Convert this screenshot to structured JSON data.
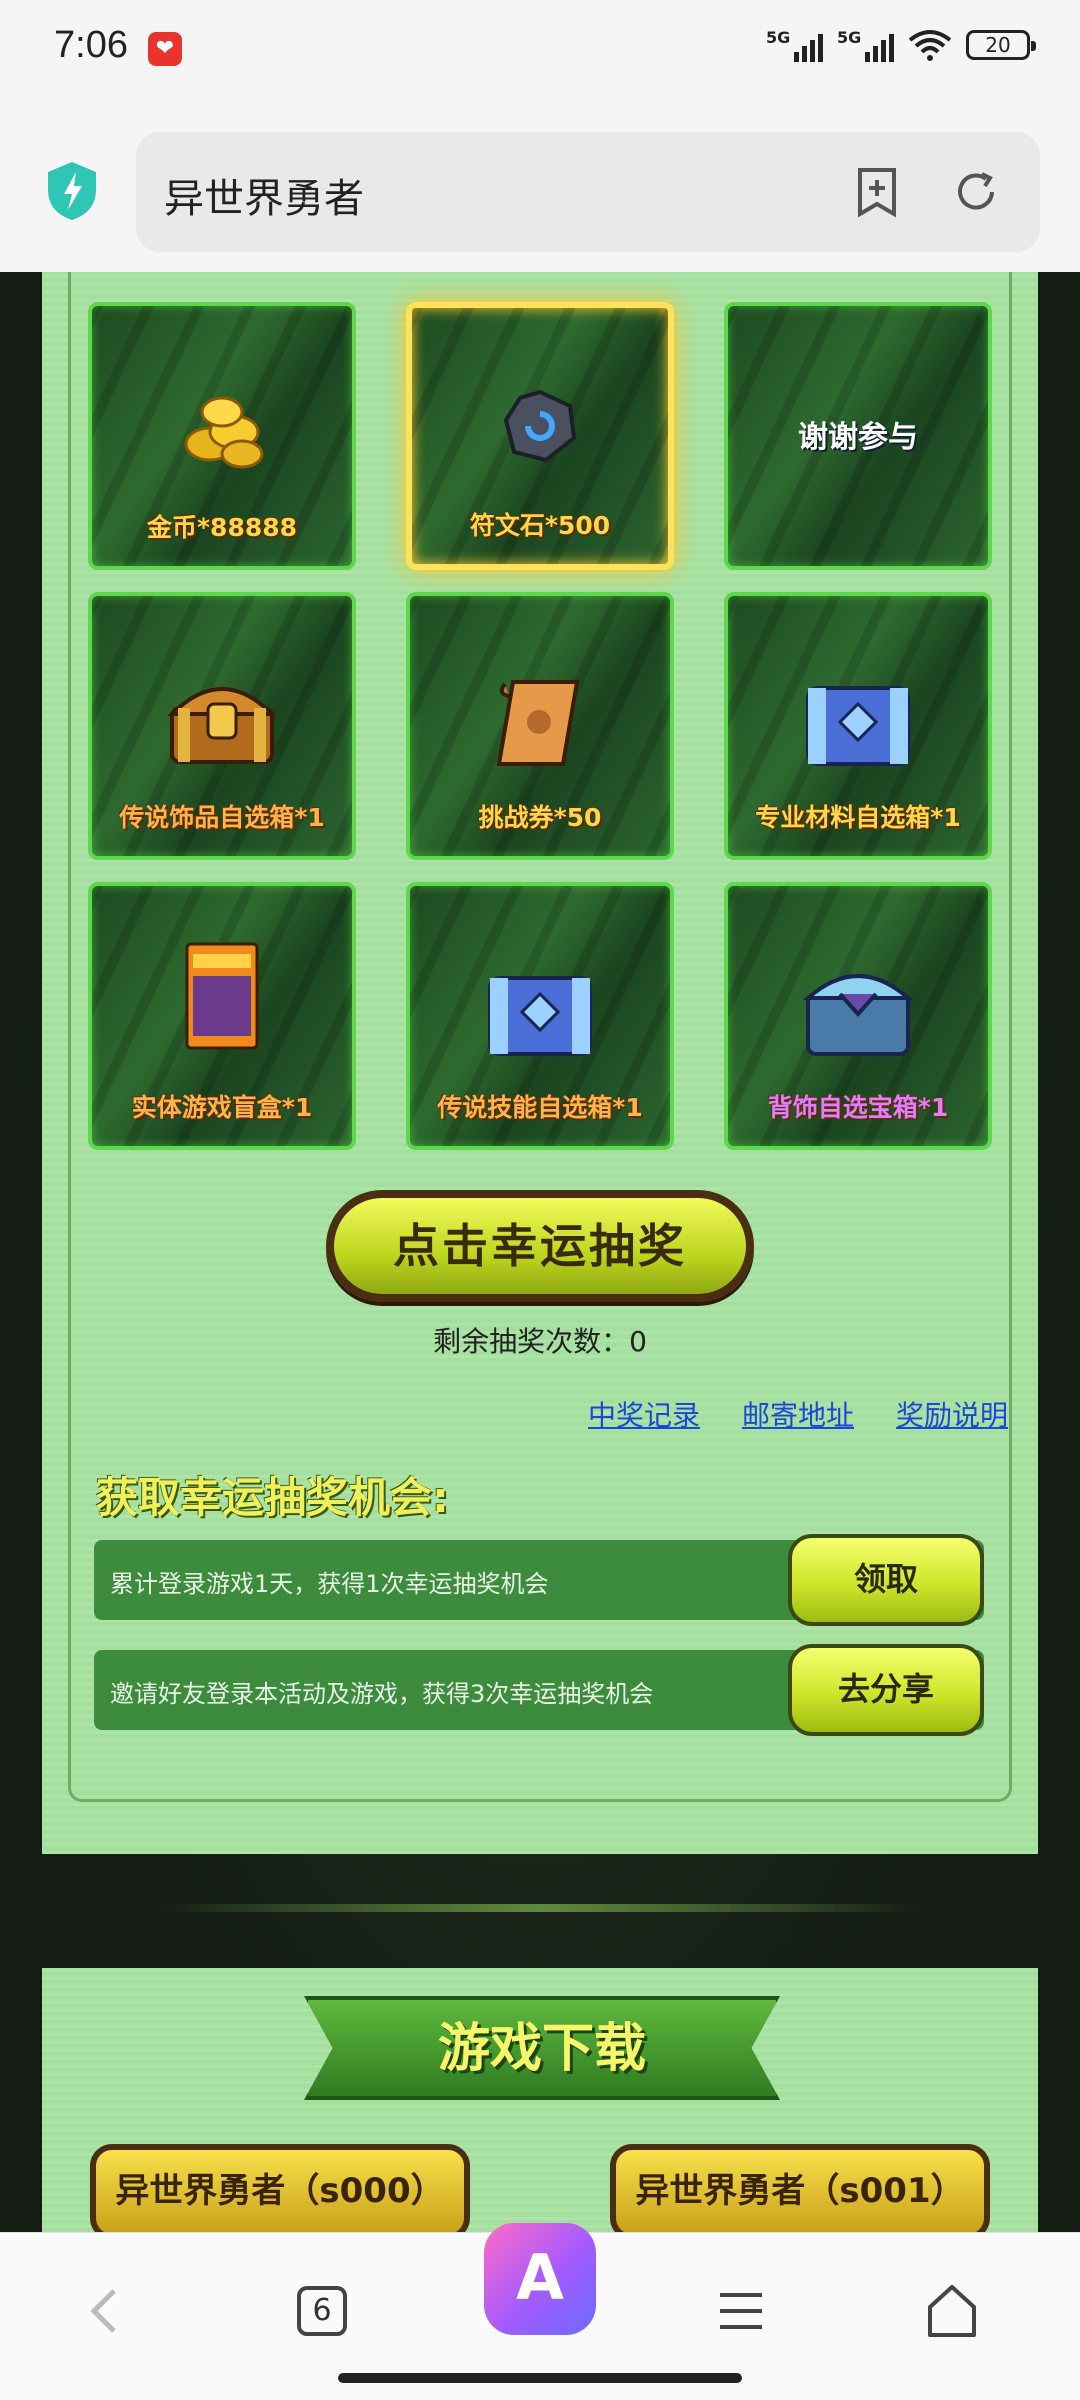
{
  "status_bar": {
    "time": "7:06",
    "app_badge_icon": "vivo-heart-icon",
    "network1": "5G",
    "network2": "5G",
    "battery": "20"
  },
  "address_bar": {
    "title": "异世界勇者",
    "icons": [
      "shield-bolt-icon",
      "bookmark-plus-icon",
      "reload-icon"
    ]
  },
  "prize_grid": [
    {
      "label": "金币*88888",
      "icon": "gold-coins-icon",
      "style": "gold"
    },
    {
      "label": "符文石*500",
      "icon": "rune-stone-icon",
      "style": "gold",
      "selected": true
    },
    {
      "label": "谢谢参与",
      "icon": "",
      "style": "white"
    },
    {
      "label": "传说饰品自选箱*1",
      "icon": "gold-chest-icon",
      "style": "orange"
    },
    {
      "label": "挑战券*50",
      "icon": "scroll-ticket-icon",
      "style": "gold"
    },
    {
      "label": "专业材料自选箱*1",
      "icon": "blue-chest-icon",
      "style": "gold"
    },
    {
      "label": "实体游戏盲盒*1",
      "icon": "blind-box-icon",
      "style": "orange"
    },
    {
      "label": "传说技能自选箱*1",
      "icon": "blue-chest-icon",
      "style": "orange"
    },
    {
      "label": "背饰自选宝箱*1",
      "icon": "purple-chest-icon",
      "style": "purple"
    }
  ],
  "draw": {
    "button_label": "点击幸运抽奖",
    "remaining_label": "剩余抽奖次数：",
    "remaining_count": "0"
  },
  "links": {
    "records": "中奖记录",
    "address": "邮寄地址",
    "rules": "奖励说明"
  },
  "get_chances": {
    "title": "获取幸运抽奖机会:",
    "tasks": [
      {
        "text": "累计登录游戏1天，获得1次幸运抽奖机会",
        "button": "领取"
      },
      {
        "text": "邀请好友登录本活动及游戏，获得3次幸运抽奖机会",
        "button": "去分享"
      }
    ]
  },
  "download": {
    "title": "游戏下载",
    "servers": [
      "异世界勇者（s000）",
      "异世界勇者（s001）"
    ]
  },
  "nav": {
    "tab_count": "6",
    "icons": [
      "back-icon",
      "tabs-icon",
      "ai-assistant-icon",
      "menu-icon",
      "home-icon"
    ]
  },
  "colors": {
    "panel": "#a8e3a3",
    "cell_border": "#5ed64e",
    "selected_border": "#ffe25a",
    "link": "#1a47d8",
    "task_bg": "#3d8c3e"
  }
}
